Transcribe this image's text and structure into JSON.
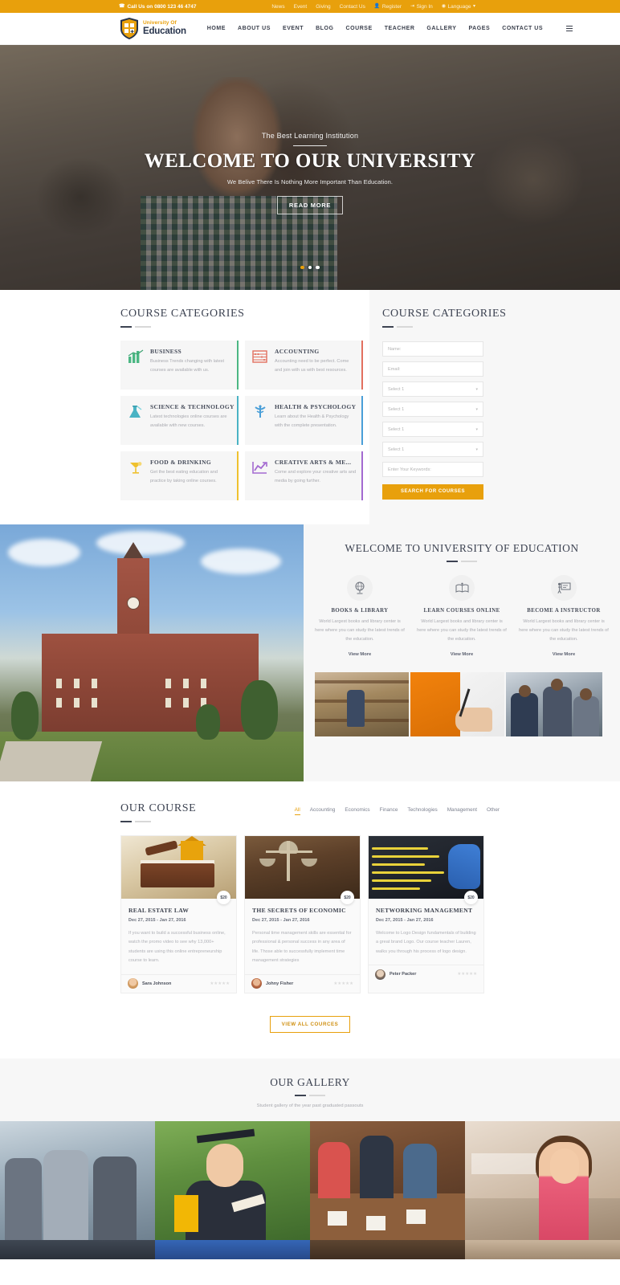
{
  "topbar": {
    "phone": "Call Us on 0800 123 46 4747",
    "phone_icon": "phone-icon",
    "links": [
      {
        "label": "News",
        "icon": null,
        "strong": false
      },
      {
        "label": "Event",
        "icon": null,
        "strong": false
      },
      {
        "label": "Giving",
        "icon": null,
        "strong": false
      },
      {
        "label": "Contact Us",
        "icon": null,
        "strong": false
      },
      {
        "label": "Register",
        "icon": "user-icon",
        "strong": true
      },
      {
        "label": "Sign In",
        "icon": "signin-icon",
        "strong": true
      },
      {
        "label": "Language",
        "icon": "globe-icon",
        "strong": true,
        "caret": true
      }
    ]
  },
  "brand": {
    "line1": "University Of",
    "line2": "Education",
    "logo_icon": "shield-logo-icon"
  },
  "nav": {
    "items": [
      {
        "label": "HOME"
      },
      {
        "label": "ABOUT US"
      },
      {
        "label": "EVENT"
      },
      {
        "label": "BLOG"
      },
      {
        "label": "COURSE"
      },
      {
        "label": "TEACHER"
      },
      {
        "label": "GALLERY"
      },
      {
        "label": "PAGES"
      },
      {
        "label": "CONTACT US"
      }
    ],
    "menu_icon": "hamburger-icon"
  },
  "hero": {
    "eyebrow": "The Best Learning Institution",
    "title": "WELCOME TO OUR UNIVERSITY",
    "tagline": "We Belive There Is Nothing More Important Than Education.",
    "cta": "READ MORE",
    "slides": 3,
    "active_slide": 1
  },
  "categories": {
    "title": "COURSE CATEGORIES",
    "items": [
      {
        "name": "BUSINESS",
        "desc": "Business Trends changing with latest courses are available with us.",
        "icon": "bar-chart-icon",
        "color": "#4bb783"
      },
      {
        "name": "ACCOUNTING",
        "desc": "Accounting need to be perfect. Come and join with us with best resources.",
        "icon": "abacus-icon",
        "color": "#e2705f"
      },
      {
        "name": "SCIENCE & TECHNOLOGY",
        "desc": "Latest technologies online courses are available with new courses.",
        "icon": "flask-icon",
        "color": "#4ab3c4"
      },
      {
        "name": "HEALTH & PSYCHOLOGY",
        "desc": "Learn about the Health & Psychology with the complete presentation.",
        "icon": "caduceus-icon",
        "color": "#4a9fd8"
      },
      {
        "name": "FOOD & DRINKING",
        "desc": "Get the best eating education and practice by taking online courses.",
        "icon": "cocktail-icon",
        "color": "#efc12e"
      },
      {
        "name": "CREATIVE ARTS & ME...",
        "desc": "Come and explore your creative arts and media by going further.",
        "icon": "trend-up-icon",
        "color": "#a46ad1"
      }
    ]
  },
  "search_panel": {
    "title": "COURSE CATEGORIES",
    "fields": [
      {
        "type": "text",
        "placeholder": "Name:",
        "name": "name-field"
      },
      {
        "type": "text",
        "placeholder": "Email:",
        "name": "email-field"
      },
      {
        "type": "select",
        "placeholder": "Select 1",
        "name": "category-select-1"
      },
      {
        "type": "select",
        "placeholder": "Select 1",
        "name": "category-select-2"
      },
      {
        "type": "select",
        "placeholder": "Select 1",
        "name": "category-select-3"
      },
      {
        "type": "select",
        "placeholder": "Select 1",
        "name": "category-select-4"
      },
      {
        "type": "text",
        "placeholder": "Enter Your Keywords:",
        "name": "keywords-field"
      }
    ],
    "button": "SEARCH FOR COURSES",
    "button_color": "#e8a00c"
  },
  "welcome": {
    "title": "WELCOME TO UNIVERSITY OF EDUCATION",
    "features": [
      {
        "title": "BOOKS & LIBRARY",
        "desc": "World Largest books and library center is here where you can study the latest trends of the education.",
        "link": "View More",
        "icon": "globe-stand-icon"
      },
      {
        "title": "LEARN COURSES ONLINE",
        "desc": "World Largest books and library center is here where you can study the latest trends of the education.",
        "link": "View More",
        "icon": "open-book-icon"
      },
      {
        "title": "BECOME A INSTRUCTOR",
        "desc": "World Largest books and library center is here where you can study the latest trends of the education.",
        "link": "View More",
        "icon": "presenter-board-icon"
      }
    ]
  },
  "our_course": {
    "title": "OUR COURSE",
    "filters": [
      {
        "label": "All",
        "active": true
      },
      {
        "label": "Accounting",
        "active": false
      },
      {
        "label": "Economics",
        "active": false
      },
      {
        "label": "Finance",
        "active": false
      },
      {
        "label": "Technologies",
        "active": false
      },
      {
        "label": "Management",
        "active": false
      },
      {
        "label": "Other",
        "active": false
      }
    ],
    "cards": [
      {
        "title": "REAL ESTATE LAW",
        "price": "$20",
        "date": "Dec 27, 2015  -  Jan 27, 2016",
        "desc": "If you want to build a successful business online, watch the promo video to see why 13,000+ students are using this online entrepreneurship course to learn.",
        "author": "Sara Johnson",
        "rating": 0,
        "image": "law-book-gavel-image"
      },
      {
        "title": "THE SECRETS OF ECONOMIC",
        "price": "$20",
        "date": "Dec 27, 2015  -  Jan 27, 2016",
        "desc": "Personal time management skills are essential for professional & personal success in any area of life. Those able to successfully implement time management strategies",
        "author": "Johny Fisher",
        "rating": 0,
        "image": "scales-of-justice-image"
      },
      {
        "title": "NETWORKING MANAGEMENT",
        "price": "$20",
        "date": "Dec 27, 2015  -  Jan 27, 2016",
        "desc": "Welcome to Logo Design fundamentals of building a great brand Logo. Our course teacher Lauren, walks you through his process of logo design.",
        "author": "Peter Packer",
        "rating": 0,
        "image": "network-cables-image"
      }
    ],
    "view_all": "VIEW ALL COURCES"
  },
  "gallery": {
    "title": "OUR GALLERY",
    "subtitle": "Student gallery of the year past graduated passouts",
    "tiles": [
      {
        "name": "students-walking-image"
      },
      {
        "name": "graduate-with-diploma-image"
      },
      {
        "name": "study-group-table-image"
      },
      {
        "name": "student-with-backpack-image"
      }
    ]
  }
}
